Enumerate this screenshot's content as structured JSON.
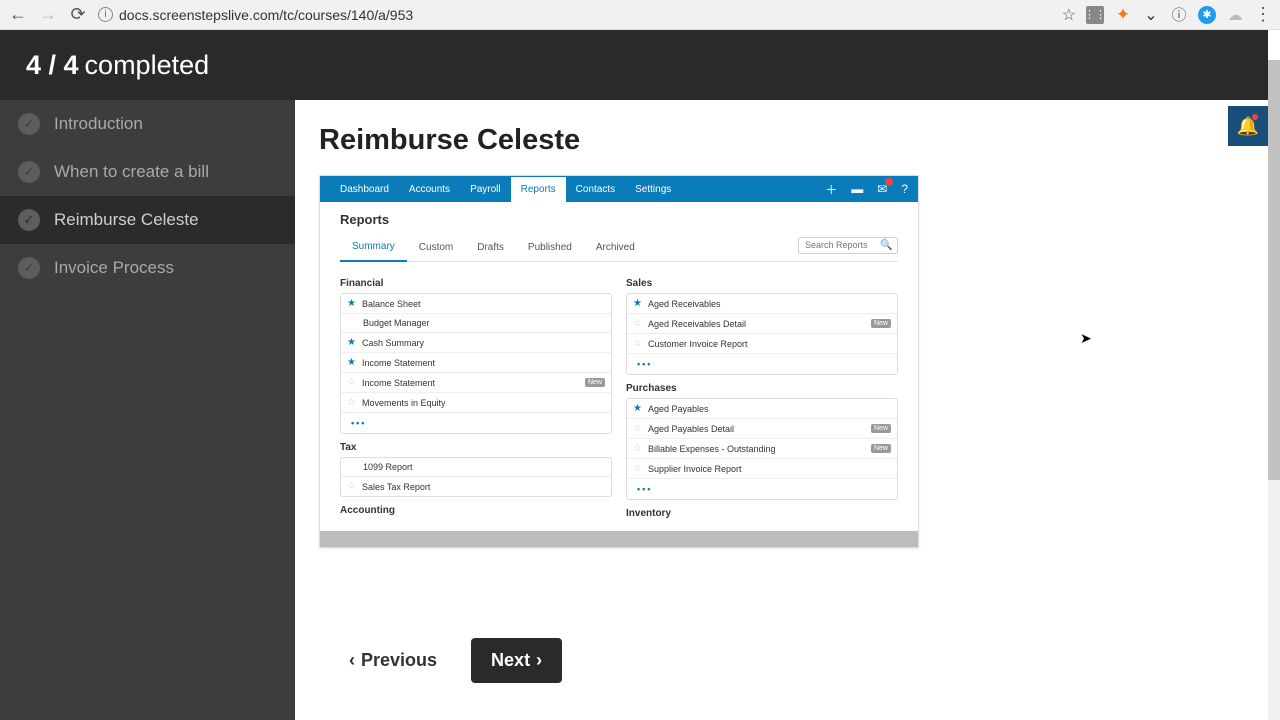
{
  "browser": {
    "url": "docs.screenstepslive.com/tc/courses/140/a/953"
  },
  "header": {
    "progress_bold": "4 / 4",
    "progress_text": "completed"
  },
  "sidebar": {
    "items": [
      {
        "label": "Introduction"
      },
      {
        "label": "When to create a bill"
      },
      {
        "label": "Reimburse Celeste"
      },
      {
        "label": "Invoice Process"
      }
    ]
  },
  "main": {
    "title": "Reimburse Celeste"
  },
  "embed": {
    "nav": [
      "Dashboard",
      "Accounts",
      "Payroll",
      "Reports",
      "Contacts",
      "Settings"
    ],
    "nav_active_index": 3,
    "heading": "Reports",
    "sub_tabs": [
      "Summary",
      "Custom",
      "Drafts",
      "Published",
      "Archived"
    ],
    "sub_active_index": 0,
    "search_placeholder": "Search Reports",
    "groups_left": [
      {
        "title": "Financial",
        "items": [
          {
            "name": "Balance Sheet",
            "fav": true
          },
          {
            "name": "Budget Manager",
            "fav": false,
            "nostar": true
          },
          {
            "name": "Cash Summary",
            "fav": true
          },
          {
            "name": "Income Statement",
            "fav": true
          },
          {
            "name": "Income Statement",
            "fav": false,
            "badge": "New"
          },
          {
            "name": "Movements in Equity",
            "fav": false
          }
        ],
        "more": true
      },
      {
        "title": "Tax",
        "items": [
          {
            "name": "1099 Report",
            "fav": false,
            "nostar": true
          },
          {
            "name": "Sales Tax Report",
            "fav": false
          }
        ]
      },
      {
        "title": "Accounting",
        "items": []
      }
    ],
    "groups_right": [
      {
        "title": "Sales",
        "items": [
          {
            "name": "Aged Receivables",
            "fav": true
          },
          {
            "name": "Aged Receivables Detail",
            "fav": false,
            "badge": "New"
          },
          {
            "name": "Customer Invoice Report",
            "fav": false
          }
        ],
        "more": true
      },
      {
        "title": "Purchases",
        "items": [
          {
            "name": "Aged Payables",
            "fav": true
          },
          {
            "name": "Aged Payables Detail",
            "fav": false,
            "badge": "New"
          },
          {
            "name": "Billable Expenses - Outstanding",
            "fav": false,
            "badge": "New"
          },
          {
            "name": "Supplier Invoice Report",
            "fav": false
          }
        ],
        "more": true
      },
      {
        "title": "Inventory",
        "items": []
      }
    ]
  },
  "pager": {
    "prev": "Previous",
    "next": "Next"
  }
}
